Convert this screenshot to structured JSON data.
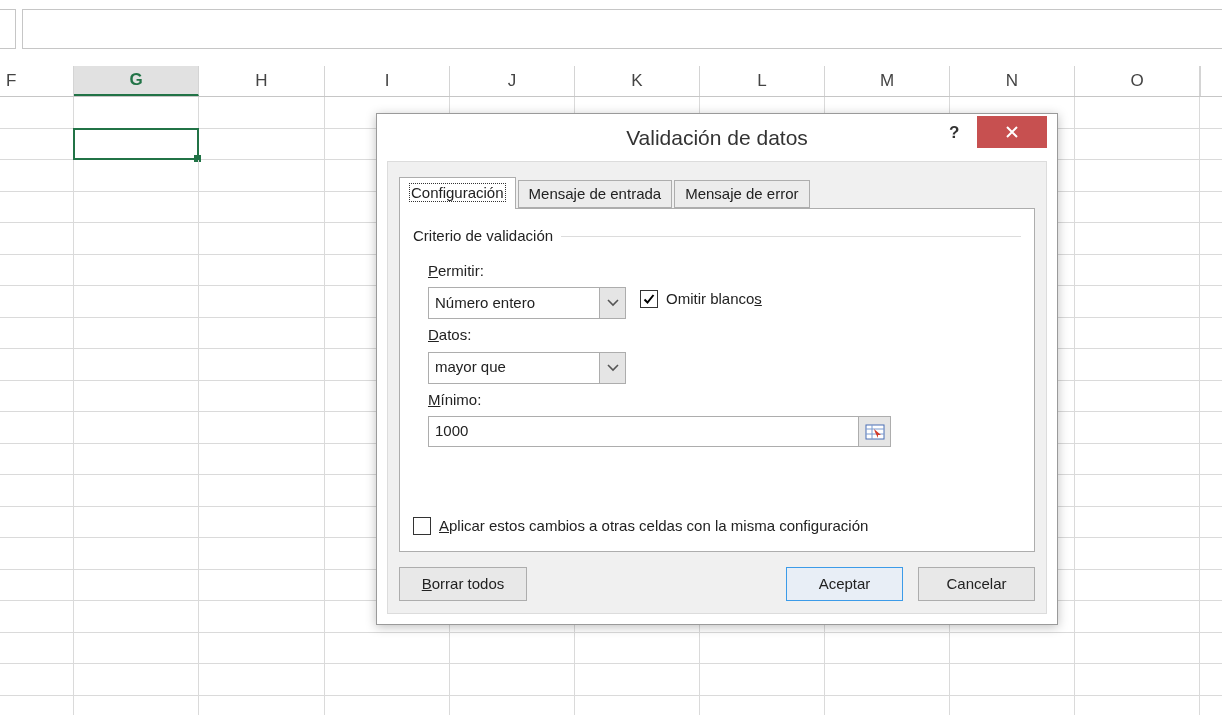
{
  "sheet": {
    "columns": [
      {
        "label": "F",
        "selected": false
      },
      {
        "label": "G",
        "selected": true
      },
      {
        "label": "H",
        "selected": false
      },
      {
        "label": "I",
        "selected": false
      },
      {
        "label": "J",
        "selected": false
      },
      {
        "label": "K",
        "selected": false
      },
      {
        "label": "L",
        "selected": false
      },
      {
        "label": "M",
        "selected": false
      },
      {
        "label": "N",
        "selected": false
      },
      {
        "label": "O",
        "selected": false
      }
    ]
  },
  "dialog": {
    "title": "Validación de datos",
    "help": "?",
    "tabs": [
      {
        "label": "Configuración",
        "selected": true
      },
      {
        "label": "Mensaje de entrada",
        "selected": false
      },
      {
        "label": "Mensaje de error",
        "selected": false
      }
    ],
    "group_title": "Criterio de validación",
    "allow": {
      "label": [
        {
          "text": "P",
          "underline": true
        },
        {
          "text": "ermitir:",
          "underline": false
        }
      ],
      "value": "Número entero"
    },
    "ignore_blank": {
      "label": [
        {
          "text": "Omitir blanco",
          "underline": false
        },
        {
          "text": "s",
          "underline": true
        }
      ],
      "checked": true
    },
    "data": {
      "label": [
        {
          "text": "D",
          "underline": true
        },
        {
          "text": "atos:",
          "underline": false
        }
      ],
      "value": "mayor que"
    },
    "minimum": {
      "label": [
        {
          "text": "M",
          "underline": true
        },
        {
          "text": "ínimo:",
          "underline": false
        }
      ],
      "value": "1000"
    },
    "apply_all": {
      "label": [
        {
          "text": "A",
          "underline": true
        },
        {
          "text": "plicar estos cambios a otras celdas con la misma configuración",
          "underline": false
        }
      ],
      "checked": false
    },
    "buttons": [
      {
        "label": [
          {
            "text": "B",
            "underline": true
          },
          {
            "text": "orrar todos",
            "underline": false
          }
        ],
        "kind": "secondary",
        "focused": false
      },
      {
        "label": [
          {
            "text": "Aceptar",
            "underline": false
          }
        ],
        "kind": "primary",
        "focused": true
      },
      {
        "label": [
          {
            "text": "Cancelar",
            "underline": false
          }
        ],
        "kind": "secondary",
        "focused": false
      }
    ]
  }
}
